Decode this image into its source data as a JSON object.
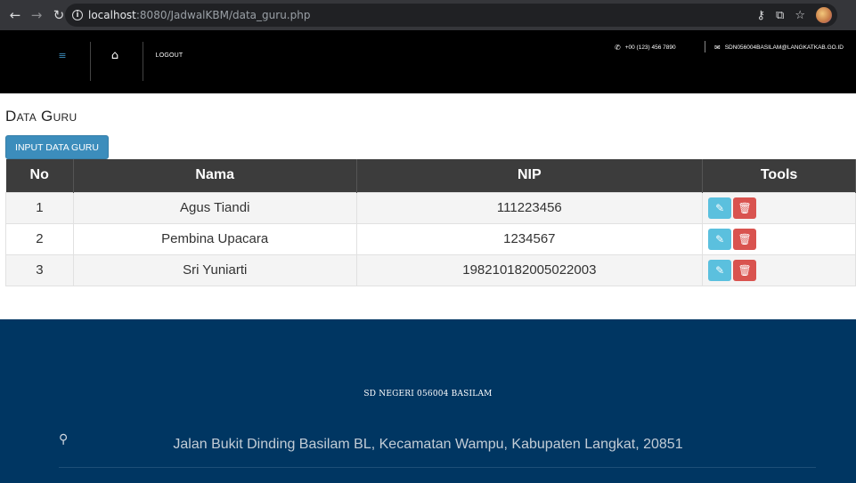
{
  "browser": {
    "url_prefix": "localhost",
    "url_rest": ":8080/JadwalKBM/data_guru.php",
    "icons": [
      "back-icon",
      "forward-icon",
      "reload-icon",
      "info-icon",
      "key-icon",
      "translate-icon",
      "star-icon",
      "profile-icon"
    ]
  },
  "navbar": {
    "logout_label": "LOGOUT",
    "phone": "+00 (123) 456 7890",
    "email": "SDN056004BASILAM@LANGKATKAB.GO.ID"
  },
  "page": {
    "title": "Data Guru",
    "input_button_label": "INPUT DATA GURU"
  },
  "table": {
    "headers": [
      "No",
      "Nama",
      "NIP",
      "Tools"
    ],
    "rows": [
      {
        "no": "1",
        "nama": "Agus Tiandi",
        "nip": "111223456"
      },
      {
        "no": "2",
        "nama": "Pembina Upacara",
        "nip": "1234567"
      },
      {
        "no": "3",
        "nama": "Sri Yuniarti",
        "nip": "198210182005022003"
      }
    ]
  },
  "footer": {
    "school_name": "SD NEGERI 056004 BASILAM",
    "address": "Jalan Bukit Dinding Basilam BL, Kecamatan Wampu, Kabupaten Langkat, 20851"
  },
  "colors": {
    "primary": "#3c8dbc",
    "edit": "#5bc0de",
    "delete": "#d9534f",
    "footer": "#003662"
  }
}
